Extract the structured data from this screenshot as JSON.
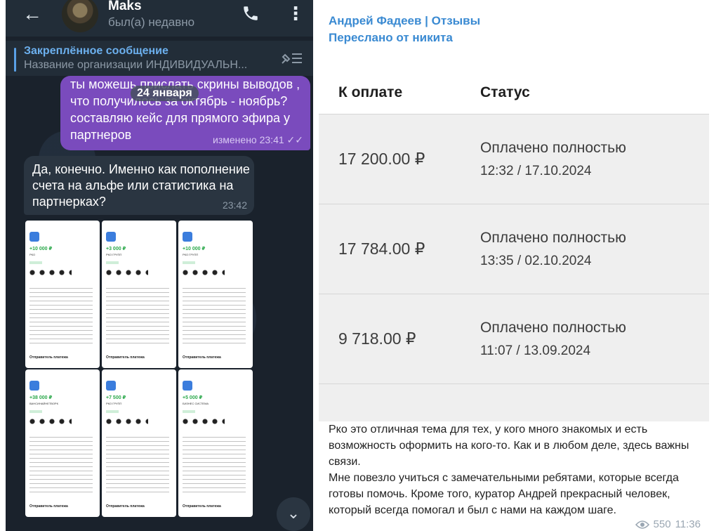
{
  "left": {
    "header": {
      "back": "←",
      "name": "Maks",
      "status": "был(а) недавно",
      "more": "⋮"
    },
    "pinned": {
      "title": "Закреплённое сообщение",
      "text": "Название организации  ИНДИВИДУАЛЬН..."
    },
    "outgoing": {
      "text": "ты можешь прислать скрины выводов , что получилось за октябрь - ноябрь? составляю кейс для прямого эфира у партнеров",
      "meta": "изменено 23:41 ✓✓"
    },
    "date_chip": "24 января",
    "incoming": {
      "text": "Да, конечно. Именно как пополнение счета на альфе или статистика на партнерках?",
      "time": "23:42"
    },
    "album": [
      {
        "amount": "+10 000 ₽",
        "sub": "РКО",
        "footer": "Отправитель платежа"
      },
      {
        "amount": "+3 000 ₽",
        "sub": "РКО ГРУПП",
        "footer": "Отправитель платежа"
      },
      {
        "amount": "+10 000 ₽",
        "sub": "РКО ГРУПП",
        "footer": "Отправитель платежа"
      },
      {
        "amount": "+38 000 ₽",
        "sub": "ВАНСИНАЙНЕТВОРК",
        "footer": "Отправитель платежа"
      },
      {
        "amount": "+7 500 ₽",
        "sub": "РКО ГРУПП",
        "footer": "Отправитель платежа"
      },
      {
        "amount": "+5 000 ₽",
        "sub": "БИЗНЕС СИСТЕМА",
        "footer": "Отправитель платежа"
      }
    ],
    "scroll_down": "⌄"
  },
  "right": {
    "author": "Андрей Фадеев | Отзывы",
    "forwarded": "Переслано от никита",
    "table": {
      "headers": [
        "К оплате",
        "Статус"
      ],
      "rows": [
        {
          "amount": "17 200.00 ₽",
          "status": "Оплачено полностью",
          "time": "12:32 / 17.10.2024"
        },
        {
          "amount": "17 784.00 ₽",
          "status": "Оплачено полностью",
          "time": "13:35 / 02.10.2024"
        },
        {
          "amount": "9 718.00 ₽",
          "status": "Оплачено полностью",
          "time": "11:07 / 13.09.2024"
        }
      ]
    },
    "text": "Рко это отличная тема для тех, у кого много знакомых и есть возможность оформить  на кого-то. Как и в любом деле, здесь важны связи.\nМне повезло учиться с замечательными ребятами, которые всегда готовы помочь. Кроме того, куратор Андрей прекрасный человек, который всегда помогал и был с нами на каждом шаге.",
    "views": "550",
    "time": "11:36"
  },
  "colors": {
    "accent": "#3a8ad2",
    "outgoing_bubble": "#7a4bbd",
    "incoming_bubble": "#2a3541",
    "dark_bg": "#1a222c"
  }
}
